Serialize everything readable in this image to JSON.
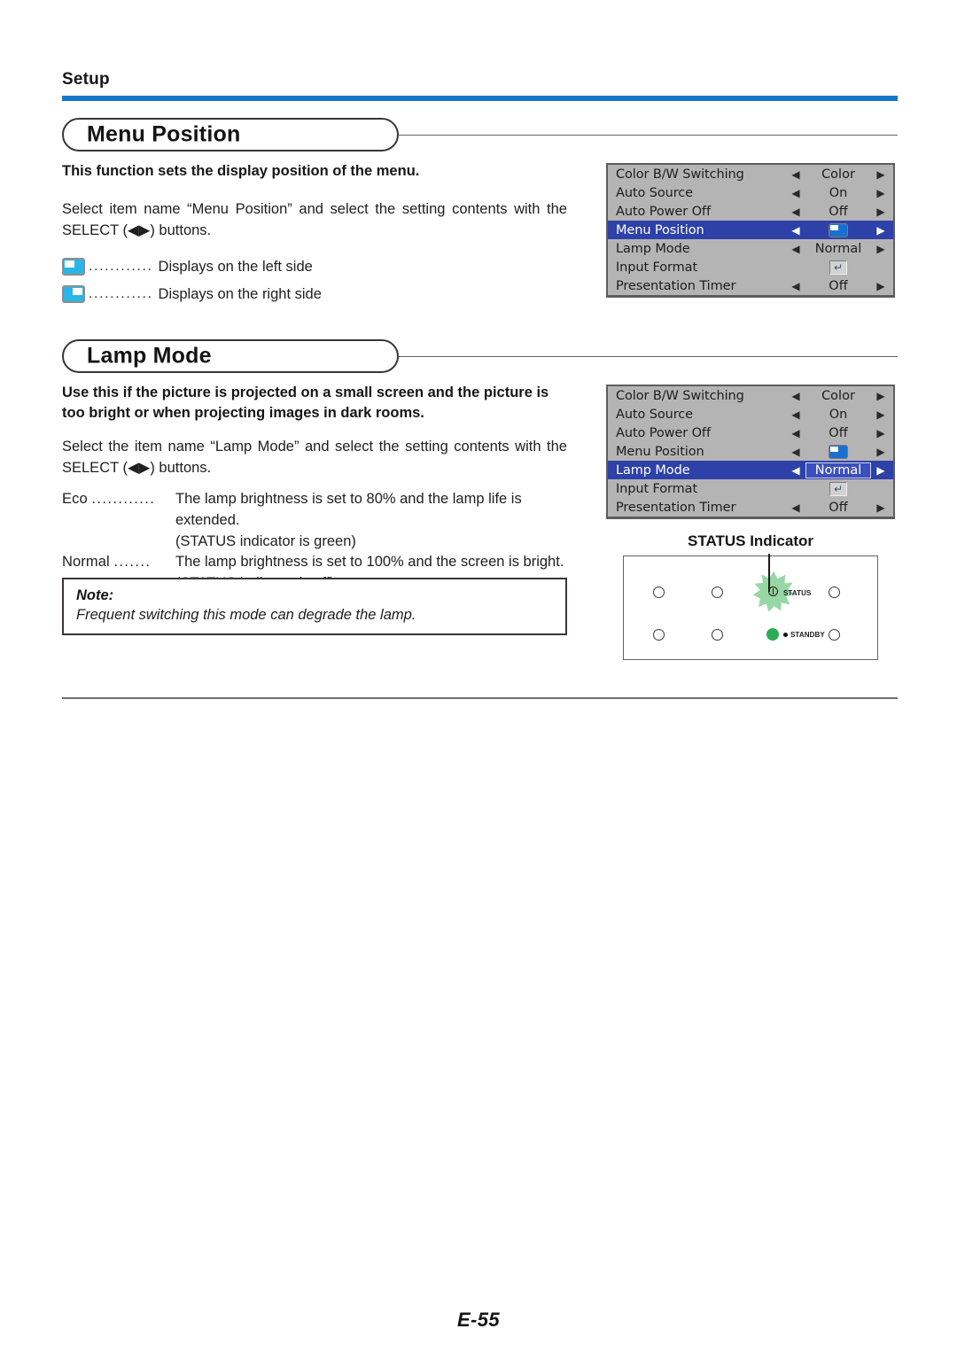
{
  "header": {
    "section_label": "Setup",
    "rule_color": "#1878c8"
  },
  "sections": [
    {
      "title": "Menu Position",
      "intro_bold": "This function sets the display position of the menu.",
      "instruction": "Select item name “Menu Position” and select the setting contents with the SELECT (◀▶) buttons.",
      "legend": [
        {
          "icon": "menu-position-left-icon",
          "dots": "............",
          "text": "Displays on the left side"
        },
        {
          "icon": "menu-position-right-icon",
          "dots": "............",
          "text": "Displays on the right side"
        }
      ]
    },
    {
      "title": "Lamp Mode",
      "intro_bold": "Use this if the picture is projected on a small screen and the picture is too bright or when projecting images in dark rooms.",
      "instruction": "Select the item name “Lamp Mode” and select the setting contents with the SELECT (◀▶) buttons.",
      "definitions": [
        {
          "term": "Eco",
          "dots": "............",
          "desc": "The lamp brightness is set to 80% and the lamp life is extended.",
          "sub": "(STATUS indicator is green)"
        },
        {
          "term": "Normal",
          "dots": ".......",
          "desc": "The lamp brightness is set to 100% and the screen is bright.",
          "sub": "(STATUS indicator is off)"
        }
      ],
      "note": {
        "title": "Note:",
        "text": "Frequent switching this mode can degrade the lamp."
      }
    }
  ],
  "osd_menu_1": {
    "selected_index": 3,
    "highlight_color": "#2e41a8",
    "rows": [
      {
        "label": "Color B/W Switching",
        "value": "Color",
        "kind": "text",
        "left_arrow": "◀",
        "right_arrow": "▶"
      },
      {
        "label": "Auto Source",
        "value": "On",
        "kind": "text",
        "left_arrow": "◀",
        "right_arrow": "▶"
      },
      {
        "label": "Auto Power Off",
        "value": "Off",
        "kind": "text",
        "left_arrow": "◀",
        "right_arrow": "▶"
      },
      {
        "label": "Menu Position",
        "value": "",
        "kind": "glyph",
        "left_arrow": "◀",
        "right_arrow": "▶"
      },
      {
        "label": "Lamp Mode",
        "value": "Normal",
        "kind": "text",
        "left_arrow": "◀",
        "right_arrow": "▶"
      },
      {
        "label": "Input Format",
        "value": "↵",
        "kind": "enter",
        "left_arrow": "",
        "right_arrow": ""
      },
      {
        "label": "Presentation Timer",
        "value": "Off",
        "kind": "text",
        "left_arrow": "◀",
        "right_arrow": "▶"
      }
    ]
  },
  "osd_menu_2": {
    "selected_index": 4,
    "highlight_color": "#2e41a8",
    "rows": [
      {
        "label": "Color B/W Switching",
        "value": "Color",
        "kind": "text",
        "left_arrow": "◀",
        "right_arrow": "▶"
      },
      {
        "label": "Auto Source",
        "value": "On",
        "kind": "text",
        "left_arrow": "◀",
        "right_arrow": "▶"
      },
      {
        "label": "Auto Power Off",
        "value": "Off",
        "kind": "text",
        "left_arrow": "◀",
        "right_arrow": "▶"
      },
      {
        "label": "Menu Position",
        "value": "",
        "kind": "glyph",
        "left_arrow": "◀",
        "right_arrow": "▶"
      },
      {
        "label": "Lamp Mode",
        "value": "Normal",
        "kind": "text",
        "left_arrow": "◀",
        "right_arrow": "▶"
      },
      {
        "label": "Input Format",
        "value": "↵",
        "kind": "enter",
        "left_arrow": "",
        "right_arrow": ""
      },
      {
        "label": "Presentation Timer",
        "value": "Off",
        "kind": "text",
        "left_arrow": "◀",
        "right_arrow": "▶"
      }
    ]
  },
  "status_indicator": {
    "title": "STATUS Indicator",
    "status_label": "STATUS",
    "standby_label": "STANDBY",
    "glow_color": "#6ec77f",
    "standby_color": "#2cac55"
  },
  "footer": {
    "page": "E-55"
  }
}
